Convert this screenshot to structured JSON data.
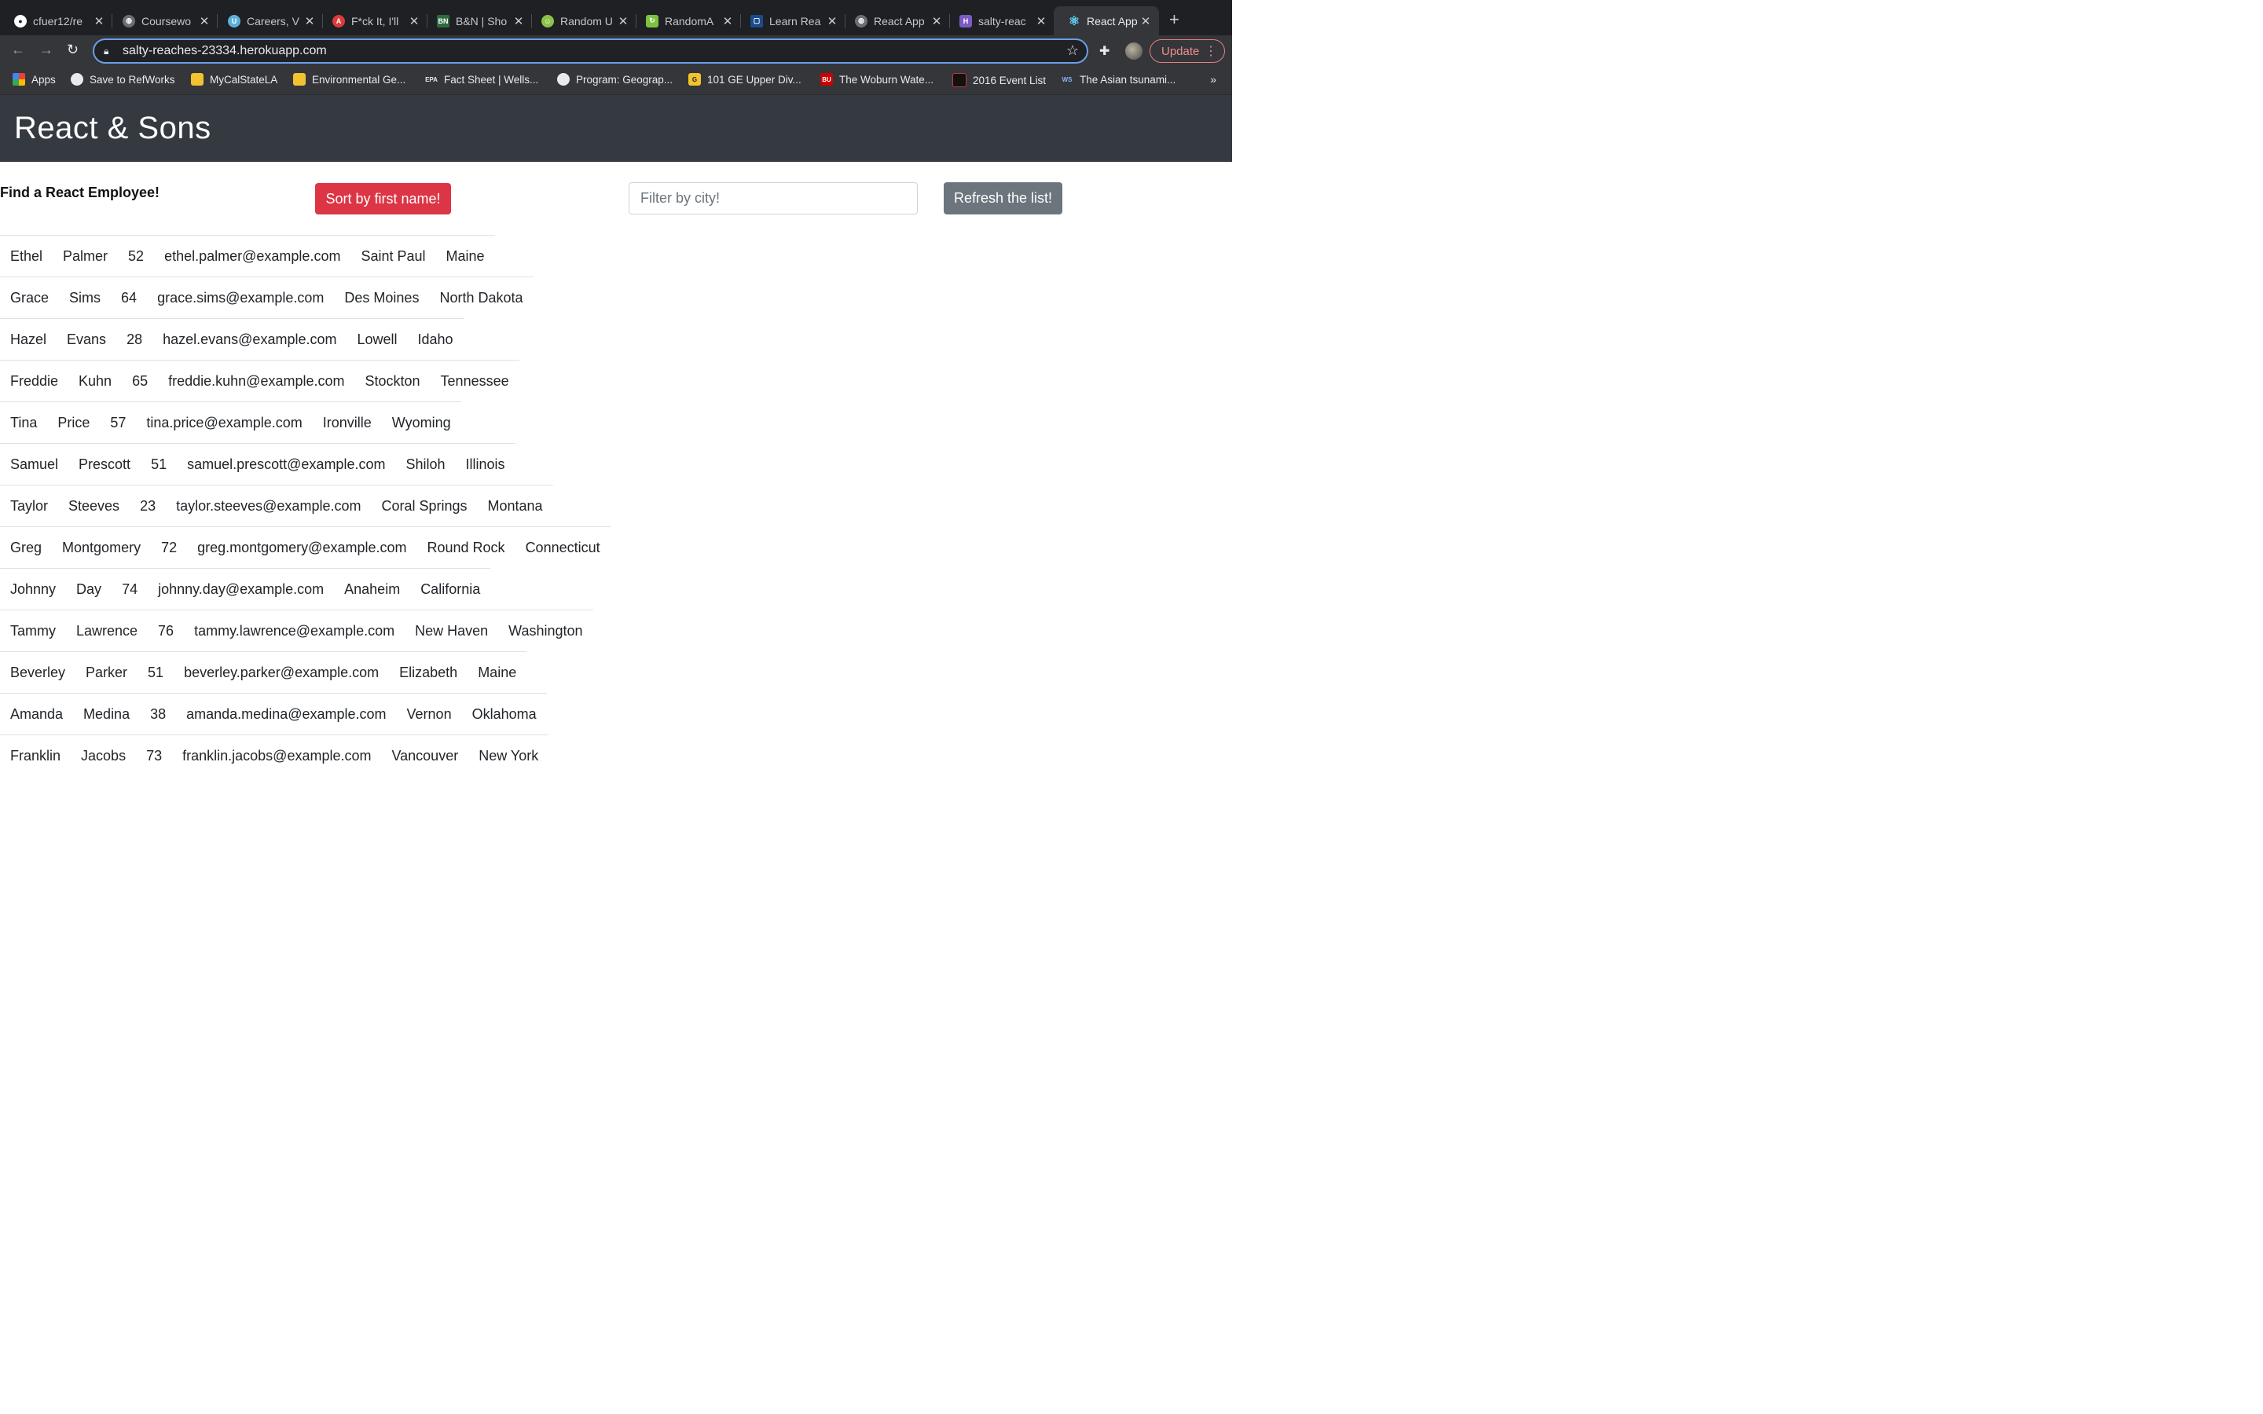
{
  "browser": {
    "tabs": [
      {
        "title": "cfuer12/re",
        "favicon": "github-icon",
        "color": "#ffffff"
      },
      {
        "title": "Coursewo",
        "favicon": "globe-icon",
        "color": "#9aa0a6"
      },
      {
        "title": "Careers, V",
        "favicon": "u-logo-icon",
        "color": "#5fb0d9"
      },
      {
        "title": "F*ck It, I'll",
        "favicon": "a-logo-icon",
        "color": "#dd3b3b"
      },
      {
        "title": "B&N | Sho",
        "favicon": "bn-logo-icon",
        "color": "#2d6b3d"
      },
      {
        "title": "Random U",
        "favicon": "smile-icon",
        "color": "#8bc34a"
      },
      {
        "title": "RandomA",
        "favicon": "refresh-logo-icon",
        "color": "#7cc242"
      },
      {
        "title": "Learn Rea",
        "favicon": "page-icon",
        "color": "#1a4b8c"
      },
      {
        "title": "React App",
        "favicon": "globe-icon",
        "color": "#9aa0a6"
      },
      {
        "title": "salty-reac",
        "favicon": "heroku-icon",
        "color": "#7b5cc4"
      },
      {
        "title": "React App",
        "favicon": "react-icon",
        "color": "#61dafb"
      }
    ],
    "url": "salty-reaches-23334.herokuapp.com",
    "update_label": "Update",
    "bookmarks": [
      {
        "label": "Apps",
        "icon": "apps-grid-icon"
      },
      {
        "label": "Save to RefWorks",
        "icon": "globe-icon"
      },
      {
        "label": "MyCalStateLA",
        "icon": "csula-icon"
      },
      {
        "label": "Environmental Ge...",
        "icon": "csula-icon"
      },
      {
        "label": "Fact Sheet | Wells...",
        "icon": "epa-icon"
      },
      {
        "label": "Program: Geograp...",
        "icon": "globe-icon"
      },
      {
        "label": "101 GE Upper Div...",
        "icon": "ge-icon"
      },
      {
        "label": "The Woburn Wate...",
        "icon": "bu-icon"
      },
      {
        "label": "2016 Event List",
        "icon": "event-icon"
      },
      {
        "label": "The Asian tsunami...",
        "icon": "ws-icon"
      }
    ]
  },
  "page": {
    "title": "React & Sons",
    "heading": "Find a React Employee!",
    "sort_label": "Sort by first name!",
    "filter_placeholder": "Filter by city!",
    "refresh_label": "Refresh the list!"
  },
  "employees": [
    [
      "Ethel",
      "Palmer",
      "52",
      "ethel.palmer@example.com",
      "Saint Paul",
      "Maine"
    ],
    [
      "Grace",
      "Sims",
      "64",
      "grace.sims@example.com",
      "Des Moines",
      "North Dakota"
    ],
    [
      "Hazel",
      "Evans",
      "28",
      "hazel.evans@example.com",
      "Lowell",
      "Idaho"
    ],
    [
      "Freddie",
      "Kuhn",
      "65",
      "freddie.kuhn@example.com",
      "Stockton",
      "Tennessee"
    ],
    [
      "Tina",
      "Price",
      "57",
      "tina.price@example.com",
      "Ironville",
      "Wyoming"
    ],
    [
      "Samuel",
      "Prescott",
      "51",
      "samuel.prescott@example.com",
      "Shiloh",
      "Illinois"
    ],
    [
      "Taylor",
      "Steeves",
      "23",
      "taylor.steeves@example.com",
      "Coral Springs",
      "Montana"
    ],
    [
      "Greg",
      "Montgomery",
      "72",
      "greg.montgomery@example.com",
      "Round Rock",
      "Connecticut"
    ],
    [
      "Johnny",
      "Day",
      "74",
      "johnny.day@example.com",
      "Anaheim",
      "California"
    ],
    [
      "Tammy",
      "Lawrence",
      "76",
      "tammy.lawrence@example.com",
      "New Haven",
      "Washington"
    ],
    [
      "Beverley",
      "Parker",
      "51",
      "beverley.parker@example.com",
      "Elizabeth",
      "Maine"
    ],
    [
      "Amanda",
      "Medina",
      "38",
      "amanda.medina@example.com",
      "Vernon",
      "Oklahoma"
    ],
    [
      "Franklin",
      "Jacobs",
      "73",
      "franklin.jacobs@example.com",
      "Vancouver",
      "New York"
    ]
  ]
}
